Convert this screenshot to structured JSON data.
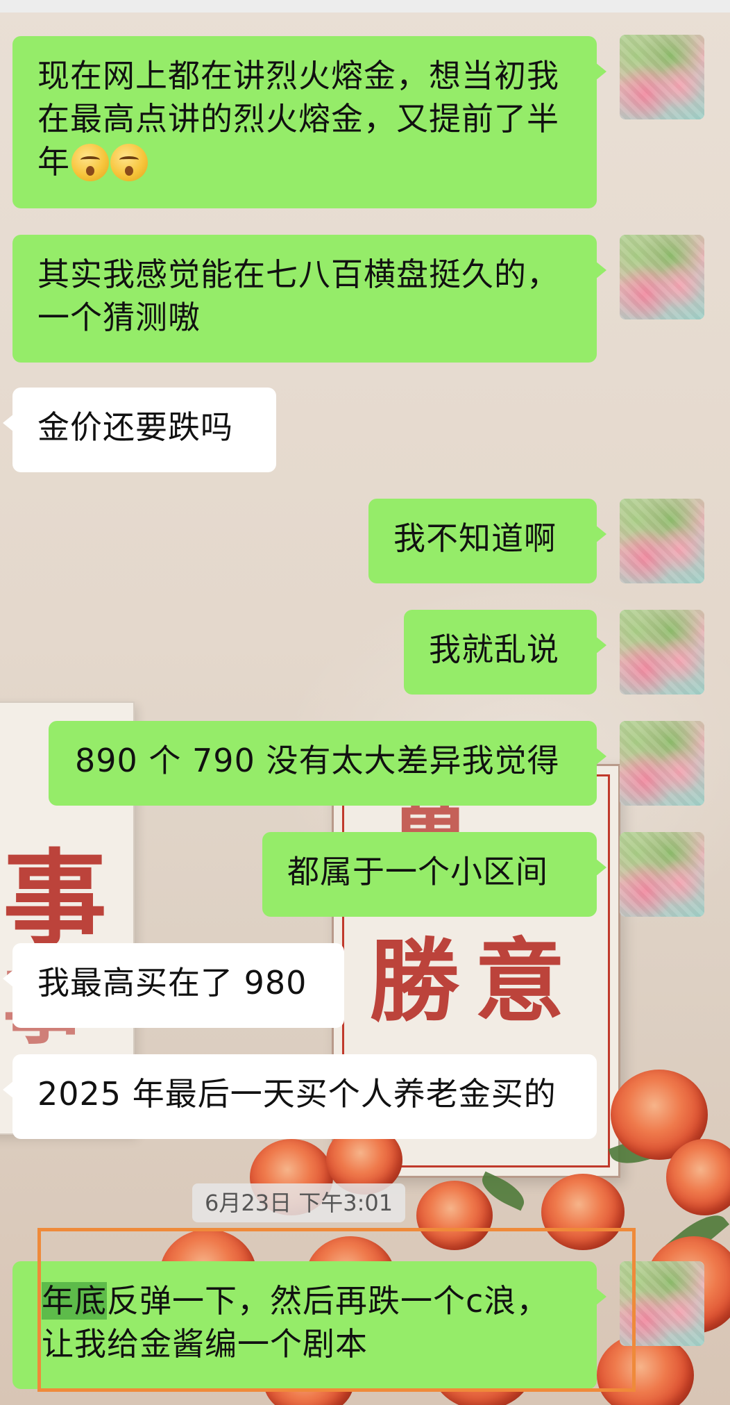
{
  "messages": [
    {
      "side": "out",
      "text": "现在网上都在讲烈火熔金，想当初我在最高点讲的烈火熔金，又提前了半年",
      "emoji_count": 2
    },
    {
      "side": "out",
      "text": "其实我感觉能在七八百横盘挺久的，一个猜测嗷"
    },
    {
      "side": "in",
      "text": "金价还要跌吗"
    },
    {
      "side": "out",
      "text": "我不知道啊"
    },
    {
      "side": "out",
      "text": "我就乱说"
    },
    {
      "side": "out",
      "text": "890 个 790 没有太大差异我觉得"
    },
    {
      "side": "out",
      "text": "都属于一个小区间"
    },
    {
      "side": "in",
      "text": "我最高买在了 980"
    },
    {
      "side": "in",
      "text": "2025 年最后一天买个人养老金买的"
    },
    {
      "side": "out",
      "text_selected": "年底",
      "text": "反弹一下，然后再跌一个c浪，让我给金酱编一个剧本"
    }
  ],
  "timestamp": "6月23日 下午3:01",
  "background_text": [
    "事",
    "勝",
    "意",
    "萬",
    "事"
  ],
  "emoji_icon": "smirking-face-emoji",
  "colors": {
    "outgoing_bubble": "#95ec69",
    "incoming_bubble": "#ffffff",
    "highlight_box": "#ef8a3a",
    "selection": "#5dbb4a"
  }
}
